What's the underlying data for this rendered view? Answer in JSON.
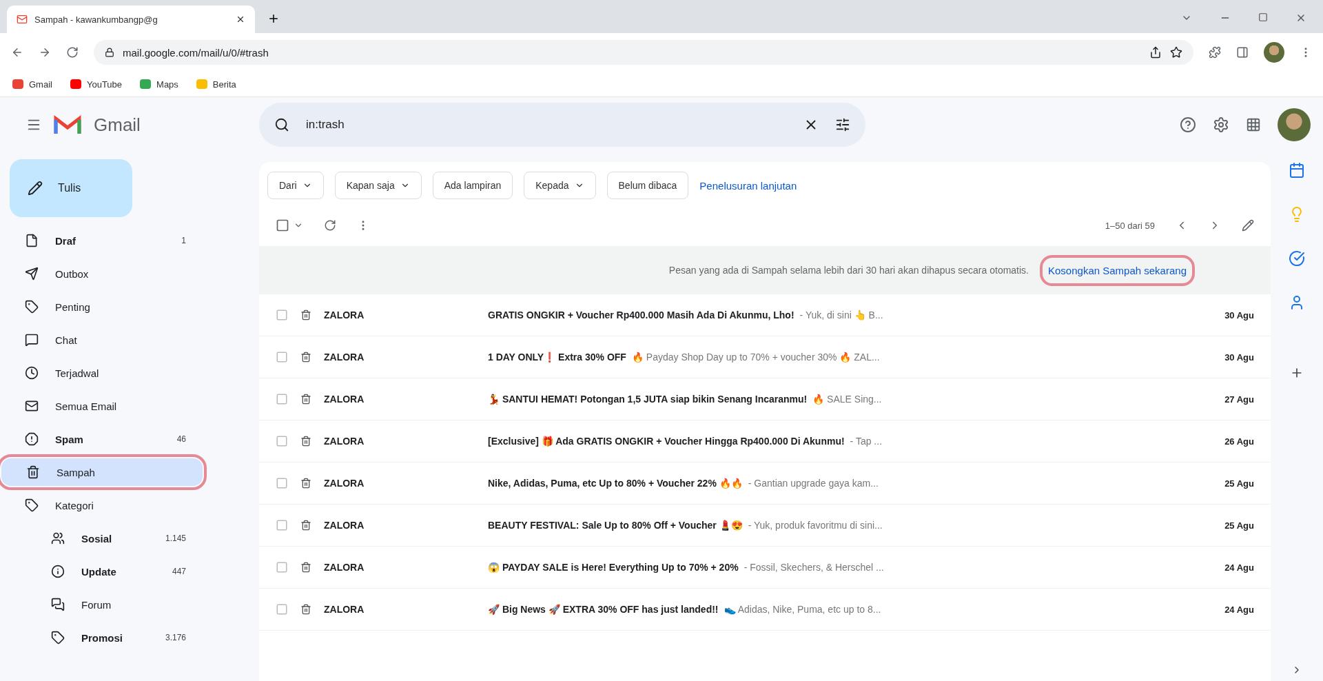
{
  "browser": {
    "tabs": [
      {
        "title": "Sampah - kawankumbangp@g",
        "selected": true
      }
    ],
    "url": "mail.google.com/mail/u/0/#trash",
    "bookmarks": [
      {
        "label": "Gmail",
        "color": "#ea4335"
      },
      {
        "label": "YouTube",
        "color": "#ff0000"
      },
      {
        "label": "Maps",
        "color": "#34a853"
      },
      {
        "label": "Berita",
        "color": "#fbbc04"
      }
    ]
  },
  "app": {
    "brand": "Gmail",
    "compose": "Tulis",
    "search": {
      "value": "in:trash"
    }
  },
  "nav": [
    {
      "label": "Draf",
      "count": "1",
      "bold": true,
      "selected": false,
      "highlighted": false,
      "kind": "draft"
    },
    {
      "label": "Outbox",
      "bold": false,
      "selected": false,
      "highlighted": false,
      "kind": "outbox"
    },
    {
      "label": "Penting",
      "bold": false,
      "selected": false,
      "highlighted": false,
      "kind": "important"
    },
    {
      "label": "Chat",
      "bold": false,
      "selected": false,
      "highlighted": false,
      "kind": "chat"
    },
    {
      "label": "Terjadwal",
      "bold": false,
      "selected": false,
      "highlighted": false,
      "kind": "scheduled"
    },
    {
      "label": "Semua Email",
      "bold": false,
      "selected": false,
      "highlighted": false,
      "kind": "all"
    },
    {
      "label": "Spam",
      "count": "46",
      "bold": true,
      "selected": false,
      "highlighted": false,
      "kind": "spam"
    },
    {
      "label": "Sampah",
      "bold": false,
      "selected": true,
      "highlighted": true,
      "kind": "trash"
    },
    {
      "label": "Kategori",
      "bold": false,
      "selected": false,
      "highlighted": false,
      "kind": "category",
      "children": [
        {
          "label": "Sosial",
          "count": "1.145",
          "bold": true,
          "selected": false,
          "highlighted": false,
          "kind": "social"
        },
        {
          "label": "Update",
          "count": "447",
          "bold": true,
          "selected": false,
          "highlighted": false,
          "kind": "updates"
        },
        {
          "label": "Forum",
          "bold": false,
          "selected": false,
          "highlighted": false,
          "kind": "forum"
        },
        {
          "label": "Promosi",
          "count": "3.176",
          "bold": true,
          "selected": false,
          "highlighted": false,
          "kind": "promo"
        }
      ]
    }
  ],
  "filters": [
    {
      "label": "Dari",
      "dropdown": true
    },
    {
      "label": "Kapan saja",
      "dropdown": true
    },
    {
      "label": "Ada lampiran",
      "dropdown": false
    },
    {
      "label": "Kepada",
      "dropdown": true
    },
    {
      "label": "Belum dibaca",
      "dropdown": false
    }
  ],
  "advanced_search": "Penelusuran lanjutan",
  "select_all": {
    "checked": false
  },
  "pagination": "1–50 dari 59",
  "banner": {
    "text": "Pesan yang ada di Sampah selama lebih dari 30 hari akan dihapus secara otomatis.",
    "link": "Kosongkan Sampah sekarang",
    "highlighted": true
  },
  "emails": [
    {
      "sender": "ZALORA",
      "subject": "GRATIS ONGKIR + Voucher Rp400.000 Masih Ada Di Akunmu, Lho!",
      "snippet": "- Yuk, di sini 👆 B...",
      "date": "30 Agu",
      "unread": true
    },
    {
      "sender": "ZALORA",
      "subject": "1 DAY ONLY❗ Extra 30% OFF",
      "snippet": "🔥 Payday Shop Day up to 70% + voucher 30% 🔥 ZAL...",
      "date": "30 Agu",
      "unread": true
    },
    {
      "sender": "ZALORA",
      "subject": "💃 SANTUI HEMAT! Potongan 1,5 JUTA siap bikin Senang Incaranmu!",
      "snippet": "🔥 SALE Sing...",
      "date": "27 Agu",
      "unread": true
    },
    {
      "sender": "ZALORA",
      "subject": "[Exclusive] 🎁 Ada GRATIS ONGKIR + Voucher Hingga Rp400.000 Di Akunmu!",
      "snippet": "- Tap ...",
      "date": "26 Agu",
      "unread": true
    },
    {
      "sender": "ZALORA",
      "subject": "Nike, Adidas, Puma, etc Up to 80% + Voucher 22% 🔥🔥",
      "snippet": "- Gantian upgrade gaya kam...",
      "date": "25 Agu",
      "unread": true
    },
    {
      "sender": "ZALORA",
      "subject": "BEAUTY FESTIVAL: Sale Up to 80% Off + Voucher 💄😍",
      "snippet": "- Yuk, produk favoritmu di sini...",
      "date": "25 Agu",
      "unread": true
    },
    {
      "sender": "ZALORA",
      "subject": "😱 PAYDAY SALE is Here! Everything Up to 70% + 20%",
      "snippet": "- Fossil, Skechers, & Herschel ...",
      "date": "24 Agu",
      "unread": true
    },
    {
      "sender": "ZALORA",
      "subject": "🚀 Big News 🚀 EXTRA 30% OFF has just landed!!",
      "snippet": "👟 Adidas, Nike, Puma, etc up to 8...",
      "date": "24 Agu",
      "unread": true
    }
  ]
}
